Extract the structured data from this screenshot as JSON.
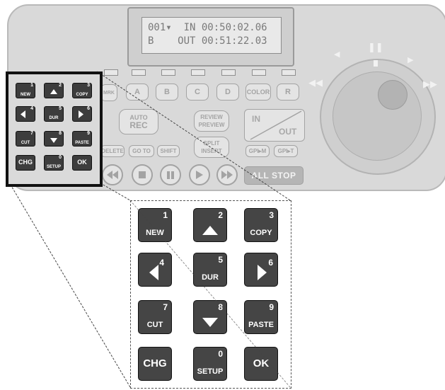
{
  "lcd": {
    "line1": "001▾  IN 00:50:02.06",
    "line2": "B    OUT 00:51:22.03"
  },
  "soft_buttons": {
    "mark": "MRK",
    "a": "A",
    "b": "B",
    "c": "C",
    "d": "D",
    "color": "COLOR",
    "r": "R"
  },
  "auto_rec": {
    "line1": "AUTO",
    "line2": "REC"
  },
  "review_preview": {
    "line1": "REVIEW",
    "line2": "PREVIEW"
  },
  "split_insert": {
    "line1": "SPLIT",
    "line2": "INSERT"
  },
  "in_out": {
    "in": "IN",
    "out": "OUT"
  },
  "small_buttons": {
    "delete": "DELETE",
    "goto": "GO TO",
    "shift": "SHIFT",
    "gpi_m": "GPI▸M",
    "gpi_t": "GPI▸T"
  },
  "transport": [
    "rewind-icon",
    "stop-icon",
    "pause-icon",
    "play-icon",
    "fast-forward-icon"
  ],
  "all_stop": "ALL STOP",
  "keypad": {
    "k1": {
      "num": "1",
      "label": "NEW"
    },
    "k2": {
      "num": "2",
      "icon": "arrow-up-icon"
    },
    "k3": {
      "num": "3",
      "label": "COPY"
    },
    "k4": {
      "num": "4",
      "icon": "arrow-left-icon"
    },
    "k5": {
      "num": "5",
      "label": "DUR"
    },
    "k6": {
      "num": "6",
      "icon": "arrow-right-icon"
    },
    "k7": {
      "num": "7",
      "label": "CUT"
    },
    "k8": {
      "num": "8",
      "icon": "arrow-down-icon"
    },
    "k9": {
      "num": "9",
      "label": "PASTE"
    },
    "chg": {
      "label": "CHG"
    },
    "k0": {
      "num": "0",
      "label": "SETUP"
    },
    "ok": {
      "label": "OK"
    }
  },
  "colors": {
    "panel": "#d9d9d9",
    "key": "#454545",
    "highlight_border": "#111111"
  }
}
